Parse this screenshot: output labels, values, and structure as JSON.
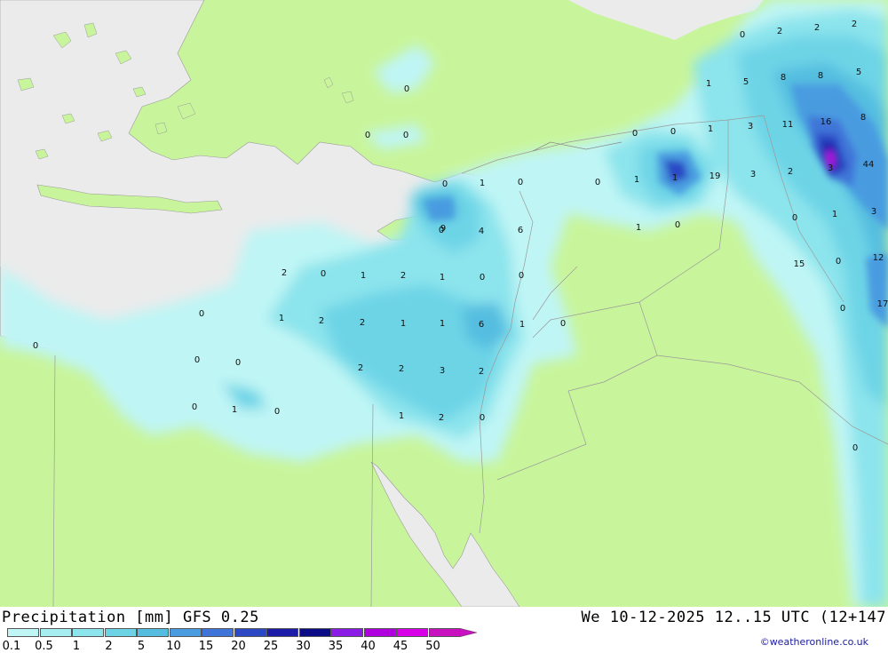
{
  "title": "Precipitation [mm] GFS 0.25",
  "valid_time": "We 10-12-2025 12..15 UTC (12+147",
  "credit": "©weatheronline.co.uk",
  "colors": {
    "land": "#c8f59b",
    "sea": "#ebebeb",
    "border": "#a6a6a6"
  },
  "legend": {
    "labels": [
      "0.1",
      "0.5",
      "1",
      "2",
      "5",
      "10",
      "15",
      "20",
      "25",
      "30",
      "35",
      "40",
      "45",
      "50"
    ],
    "colors": [
      "#bff5f5",
      "#a6eef0",
      "#8ce4ec",
      "#6dd4e6",
      "#55bde0",
      "#4a9be0",
      "#3f75d8",
      "#2c48c4",
      "#1c1ca8",
      "#0b0b86",
      "#8a1ce6",
      "#b000e0",
      "#d800e6",
      "#c810c0"
    ]
  },
  "map_values": [
    "0",
    "2",
    "2",
    "2",
    "0",
    "1",
    "5",
    "8",
    "5",
    "8",
    "0",
    "0",
    "1",
    "3",
    "11",
    "16",
    "8",
    "0",
    "0",
    "1",
    "0",
    "0",
    "1",
    "19",
    "3",
    "2",
    "3",
    "44",
    "9",
    "1",
    "0",
    "0",
    "4",
    "6",
    "1",
    "0",
    "0",
    "1",
    "3",
    "15",
    "0",
    "1",
    "2",
    "2",
    "0",
    "1",
    "0",
    "12",
    "0",
    "2",
    "1",
    "1",
    "6",
    "1",
    "0",
    "17",
    "0",
    "1",
    "0",
    "0",
    "2",
    "2",
    "3",
    "2",
    "2",
    "0",
    "0",
    "0",
    "1",
    "2",
    "0",
    "0",
    "0",
    "1"
  ]
}
